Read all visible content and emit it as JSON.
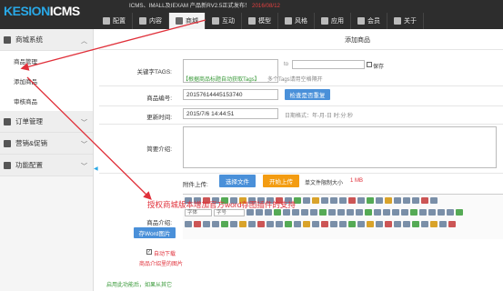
{
  "header": {
    "logo_k": "KESION",
    "logo_i": "ICMS",
    "notice": "ICMS、IMALL及IEXAM 产品新RV2.5正式发布！",
    "notice_date": "2016/08/12",
    "nav": [
      {
        "label": "配置",
        "icon": "gear-icon"
      },
      {
        "label": "内容",
        "icon": "document-icon"
      },
      {
        "label": "商城",
        "icon": "shop-icon"
      },
      {
        "label": "互动",
        "icon": "chat-icon"
      },
      {
        "label": "模型",
        "icon": "grid-icon"
      },
      {
        "label": "风格",
        "icon": "brush-icon"
      },
      {
        "label": "应用",
        "icon": "monitor-icon"
      },
      {
        "label": "会员",
        "icon": "user-icon"
      },
      {
        "label": "关于",
        "icon": "info-icon"
      }
    ]
  },
  "sidebar": {
    "section": "商城系统",
    "items": [
      "商品管理",
      "添加商品",
      "审核商品"
    ],
    "groups": [
      {
        "label": "订单管理",
        "icon": "cart-icon"
      },
      {
        "label": "营销&促销",
        "icon": "gift-icon"
      },
      {
        "label": "功能配置",
        "icon": "settings-icon"
      }
    ]
  },
  "form": {
    "title": "添加商品",
    "keywords_label": "关键字TAGS:",
    "keywords_link": "【根据商品标题自动获取Tags】",
    "keywords_tip": "多个Tags请用空格隔开",
    "save_label": "保存",
    "to_label": "to",
    "product_no_label": "商品编号:",
    "product_no": "20157614445153740",
    "check_duplicate": "检查是否重复",
    "update_time_label": "更新时间:",
    "update_time": "2015/7/6 14:44:51",
    "date_format": "日期格式：年-月-日 时:分:秒",
    "intro_label": "简要介绍:",
    "attach_label": "附件上传:",
    "select_file": "选择文件",
    "start_upload": "开始上传",
    "single_limit": "单文件限制大小",
    "size_limit": "1 MB",
    "detail_label": "商品介绍:",
    "save_word": "存Word图片",
    "auto_download": "自动下载",
    "auto_download_2": "商品介绍里的图片",
    "font_select": "字体",
    "size_select": "字号",
    "bottom_tip": "启用此功能后，如果从其它"
  },
  "annotation": {
    "text": "授权商城版本增加官方word存图插件的支持"
  },
  "colors": {
    "accent": "#29a8e6",
    "annotation": "#e0303a"
  }
}
